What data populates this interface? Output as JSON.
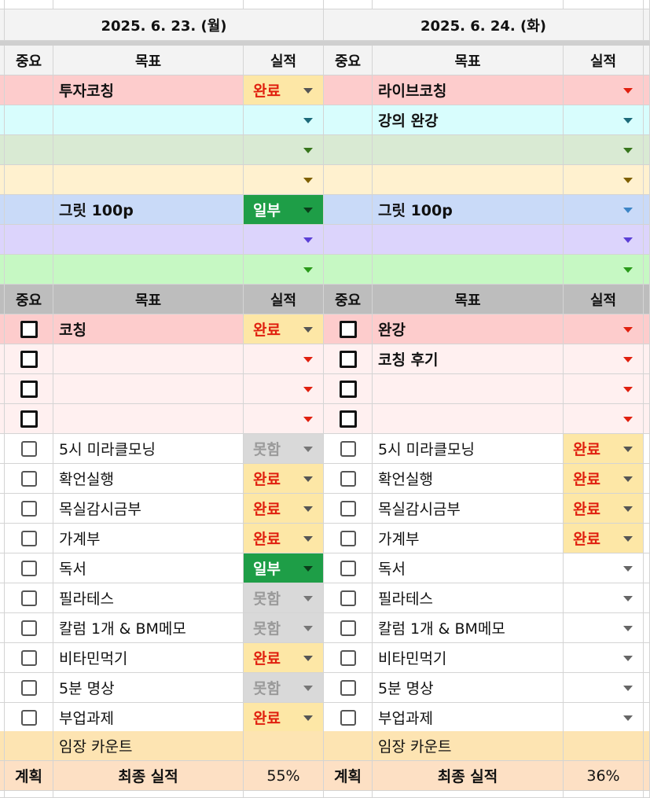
{
  "days": [
    {
      "date": "2025. 6. 23. (월)"
    },
    {
      "date": "2025. 6. 24. (화)"
    }
  ],
  "headers": {
    "importance": "중요",
    "goal": "목표",
    "result": "실적"
  },
  "priority_rows": [
    {
      "bg": "#fdcccc",
      "arrow": "#e0200f",
      "left": {
        "goal": "투자코칭",
        "status": "완료"
      },
      "right": {
        "goal": "라이브코칭",
        "status": ""
      }
    },
    {
      "bg": "#d8fdfd",
      "arrow": "#1d6a7a",
      "left": {
        "goal": "",
        "status": ""
      },
      "right": {
        "goal": "강의 완강",
        "status": ""
      }
    },
    {
      "bg": "#d9ead3",
      "arrow": "#38761d",
      "left": {
        "goal": "",
        "status": ""
      },
      "right": {
        "goal": "",
        "status": ""
      }
    },
    {
      "bg": "#fff1cf",
      "arrow": "#7f6000",
      "left": {
        "goal": "",
        "status": ""
      },
      "right": {
        "goal": "",
        "status": ""
      }
    },
    {
      "bg": "#c9daf8",
      "arrow": "#3d85c6",
      "left": {
        "goal": "그릿 100p",
        "status": "일부"
      },
      "right": {
        "goal": "그릿 100p",
        "status": ""
      }
    },
    {
      "bg": "#dcd4fc",
      "arrow": "#5b3fd6",
      "left": {
        "goal": "",
        "status": ""
      },
      "right": {
        "goal": "",
        "status": ""
      }
    },
    {
      "bg": "#c6f8c3",
      "arrow": "#2a9a1a",
      "left": {
        "goal": "",
        "status": ""
      },
      "right": {
        "goal": "",
        "status": ""
      }
    }
  ],
  "task_rows": [
    {
      "bg": "#fdcccc",
      "bold": true,
      "arrow": "#e0200f",
      "left": {
        "goal": "코칭",
        "status": "완료"
      },
      "right": {
        "goal": "완강",
        "status": ""
      }
    },
    {
      "bg": "#fff0f0",
      "bold": true,
      "arrow": "#e0200f",
      "left": {
        "goal": "",
        "status": ""
      },
      "right": {
        "goal": "코칭 후기",
        "status": ""
      }
    },
    {
      "bg": "#fff0f0",
      "bold": true,
      "arrow": "#e0200f",
      "left": {
        "goal": "",
        "status": ""
      },
      "right": {
        "goal": "",
        "status": ""
      }
    },
    {
      "bg": "#fff0f0",
      "bold": true,
      "arrow": "#e0200f",
      "left": {
        "goal": "",
        "status": ""
      },
      "right": {
        "goal": "",
        "status": ""
      }
    },
    {
      "bg": "#ffffff",
      "bold": false,
      "arrow": "#666666",
      "left": {
        "goal": "5시 미라클모닝",
        "status": "못함"
      },
      "right": {
        "goal": "5시 미라클모닝",
        "status": "완료"
      }
    },
    {
      "bg": "#ffffff",
      "bold": false,
      "arrow": "#666666",
      "left": {
        "goal": "확언실행",
        "status": "완료"
      },
      "right": {
        "goal": "확언실행",
        "status": "완료"
      }
    },
    {
      "bg": "#ffffff",
      "bold": false,
      "arrow": "#666666",
      "left": {
        "goal": "목실감시금부",
        "status": "완료"
      },
      "right": {
        "goal": "목실감시금부",
        "status": "완료"
      }
    },
    {
      "bg": "#ffffff",
      "bold": false,
      "arrow": "#666666",
      "left": {
        "goal": "가계부",
        "status": "완료"
      },
      "right": {
        "goal": "가계부",
        "status": "완료"
      }
    },
    {
      "bg": "#ffffff",
      "bold": false,
      "arrow": "#666666",
      "left": {
        "goal": "독서",
        "status": "일부"
      },
      "right": {
        "goal": "독서",
        "status": ""
      }
    },
    {
      "bg": "#ffffff",
      "bold": false,
      "arrow": "#666666",
      "left": {
        "goal": "필라테스",
        "status": "못함"
      },
      "right": {
        "goal": "필라테스",
        "status": ""
      }
    },
    {
      "bg": "#ffffff",
      "bold": false,
      "arrow": "#666666",
      "left": {
        "goal": "칼럼 1개 & BM메모",
        "status": "못함"
      },
      "right": {
        "goal": "칼럼 1개 & BM메모",
        "status": ""
      }
    },
    {
      "bg": "#ffffff",
      "bold": false,
      "arrow": "#666666",
      "left": {
        "goal": "비타민먹기",
        "status": "완료"
      },
      "right": {
        "goal": "비타민먹기",
        "status": ""
      }
    },
    {
      "bg": "#ffffff",
      "bold": false,
      "arrow": "#666666",
      "left": {
        "goal": "5분 명상",
        "status": "못함"
      },
      "right": {
        "goal": "5분 명상",
        "status": ""
      }
    },
    {
      "bg": "#ffffff",
      "bold": false,
      "arrow": "#666666",
      "left": {
        "goal": "부업과제",
        "status": "완료"
      },
      "right": {
        "goal": "부업과제",
        "status": ""
      }
    }
  ],
  "count_row": {
    "left": "임장 카운트",
    "right": "임장 카운트"
  },
  "summary_row": {
    "plan_label": "계획",
    "final_label": "최종 실적",
    "left_value": "55%",
    "right_value": "36%"
  },
  "colors": {
    "header_bg": "#f3f3f3",
    "gray_header": "#bdbdbd",
    "count_bg": "#fde4b2",
    "summary_bg": "#fde0c4"
  }
}
